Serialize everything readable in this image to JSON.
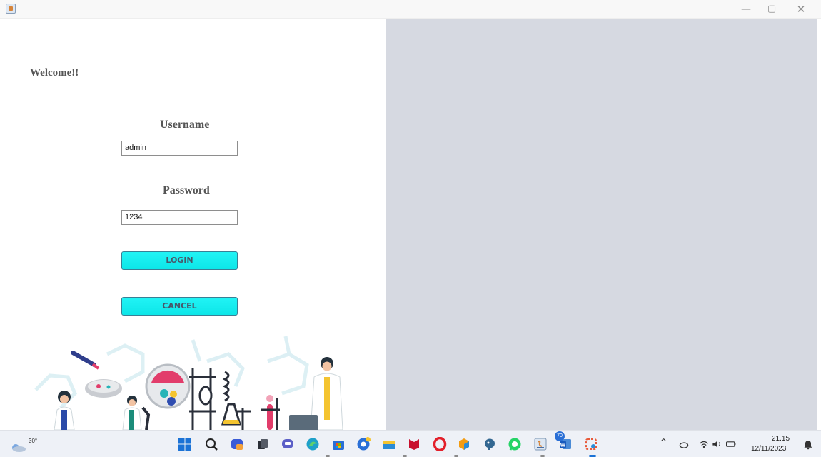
{
  "window": {
    "minimize_glyph": "—",
    "maximize_glyph": "▢",
    "close_glyph": "✕"
  },
  "login": {
    "welcome": "Welcome!!",
    "username_label": "Username",
    "username_value": "admin",
    "password_label": "Password",
    "password_value": "1234",
    "login_button": "LOGIN",
    "cancel_button": "CANCEL"
  },
  "colors": {
    "button": "#12eef0",
    "right_panel": "#d6d9e1",
    "taskbar": "#eef1f7"
  },
  "taskbar": {
    "weather_temp": "30°",
    "icons": [
      "windows-start-icon",
      "search-icon",
      "copilot-icon",
      "task-view-icon",
      "teams-chat-icon",
      "edge-icon",
      "store-icon",
      "chrome-icon",
      "file-explorer-icon",
      "mcafee-icon",
      "opera-icon",
      "app-cube-icon",
      "postgres-elephant-icon",
      "whatsapp-icon",
      "java-app-icon",
      "word-icon",
      "snipping-tool-icon"
    ],
    "whatsapp_badge": "70",
    "tray_icons": [
      "chevron-up-icon",
      "cloud-icon",
      "wifi-icon",
      "volume-icon",
      "battery-icon"
    ],
    "clock_time": "21.15",
    "clock_date": "12/11/2023"
  }
}
